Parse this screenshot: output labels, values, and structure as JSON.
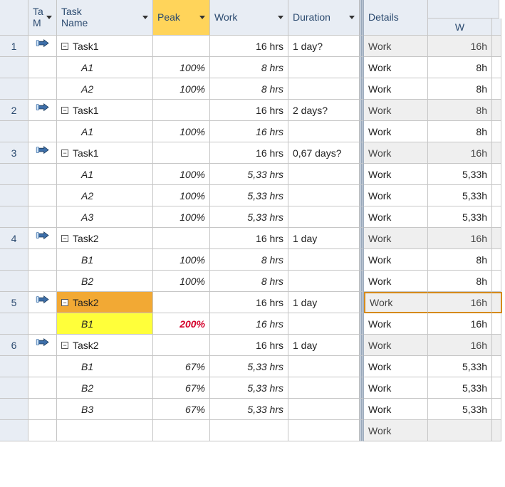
{
  "headers": {
    "taskmode": "Ta\nM",
    "taskname": "Task\nName",
    "peak": "Peak",
    "work": "Work",
    "duration": "Duration",
    "details": "Details",
    "w": "W"
  },
  "toggle_minus": "−",
  "rows": [
    {
      "num": "1",
      "icon": true,
      "name": "Task1",
      "peak": "",
      "work": "16 hrs",
      "duration": "1 day?",
      "detail": "Work",
      "w": "16h",
      "shade": true
    },
    {
      "res": "A1",
      "peak": "100%",
      "work": "8 hrs",
      "detail": "Work",
      "w": "8h"
    },
    {
      "res": "A2",
      "peak": "100%",
      "work": "8 hrs",
      "detail": "Work",
      "w": "8h"
    },
    {
      "num": "2",
      "icon": true,
      "name": "Task1",
      "peak": "",
      "work": "16 hrs",
      "duration": "2 days?",
      "detail": "Work",
      "w": "8h",
      "shade": true
    },
    {
      "res": "A1",
      "peak": "100%",
      "work": "16 hrs",
      "detail": "Work",
      "w": "8h"
    },
    {
      "num": "3",
      "icon": true,
      "name": "Task1",
      "peak": "",
      "work": "16 hrs",
      "duration": "0,67 days?",
      "detail": "Work",
      "w": "16h",
      "shade": true
    },
    {
      "res": "A1",
      "peak": "100%",
      "work": "5,33 hrs",
      "detail": "Work",
      "w": "5,33h"
    },
    {
      "res": "A2",
      "peak": "100%",
      "work": "5,33 hrs",
      "detail": "Work",
      "w": "5,33h"
    },
    {
      "res": "A3",
      "peak": "100%",
      "work": "5,33 hrs",
      "detail": "Work",
      "w": "5,33h"
    },
    {
      "num": "4",
      "icon": true,
      "name": "Task2",
      "peak": "",
      "work": "16 hrs",
      "duration": "1 day",
      "detail": "Work",
      "w": "16h",
      "shade": true
    },
    {
      "res": "B1",
      "peak": "100%",
      "work": "8 hrs",
      "detail": "Work",
      "w": "8h"
    },
    {
      "res": "B2",
      "peak": "100%",
      "work": "8 hrs",
      "detail": "Work",
      "w": "8h"
    },
    {
      "num": "5",
      "icon": true,
      "name": "Task2",
      "peak": "",
      "work": "16 hrs",
      "duration": "1 day",
      "detail": "Work",
      "w": "16h",
      "shade": true,
      "highlight": "dark"
    },
    {
      "res": "B1",
      "peak": "200%",
      "work": "16 hrs",
      "detail": "Work",
      "w": "16h",
      "highlight": "yellow",
      "peakred": true
    },
    {
      "num": "6",
      "icon": true,
      "name": "Task2",
      "peak": "",
      "work": "16 hrs",
      "duration": "1 day",
      "detail": "Work",
      "w": "16h",
      "shade": true
    },
    {
      "res": "B1",
      "peak": "67%",
      "work": "5,33 hrs",
      "detail": "Work",
      "w": "5,33h"
    },
    {
      "res": "B2",
      "peak": "67%",
      "work": "5,33 hrs",
      "detail": "Work",
      "w": "5,33h"
    },
    {
      "res": "B3",
      "peak": "67%",
      "work": "5,33 hrs",
      "detail": "Work",
      "w": "5,33h"
    },
    {
      "blank": true,
      "detail": "Work",
      "shade": true
    }
  ]
}
